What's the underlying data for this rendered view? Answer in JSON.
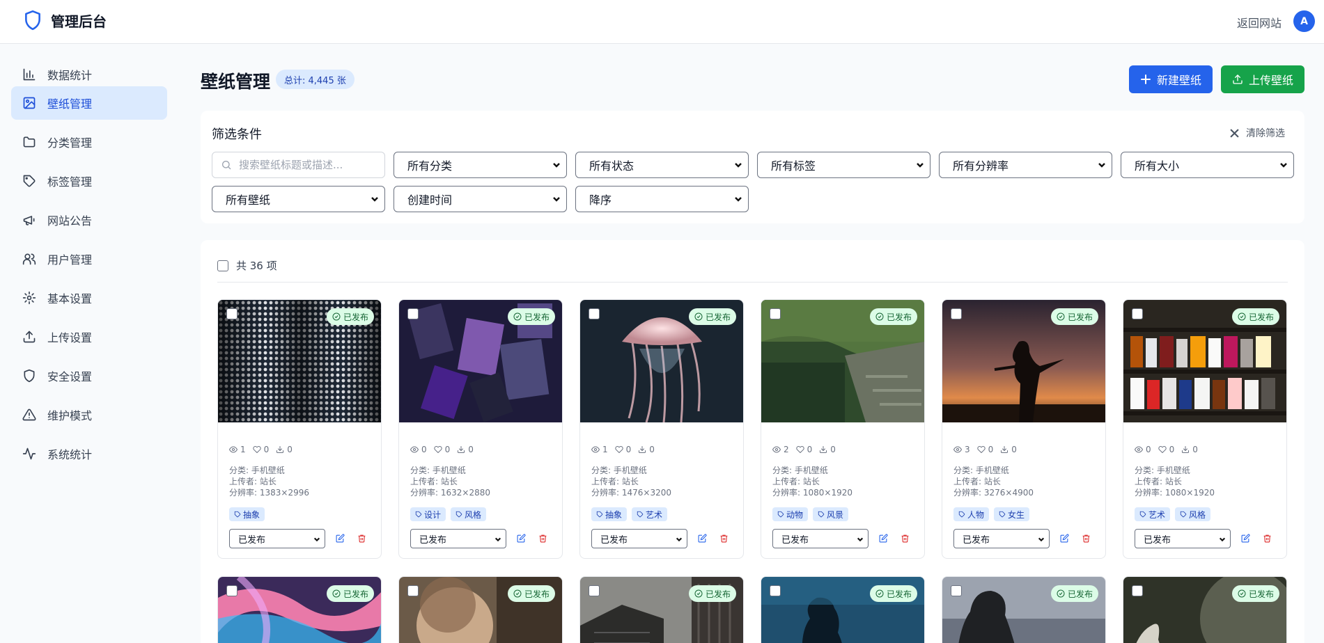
{
  "header": {
    "title": "管理后台",
    "back_link": "返回网站",
    "avatar_initial": "A"
  },
  "sidebar": {
    "items": [
      {
        "label": "数据统计",
        "icon": "bar-chart-icon"
      },
      {
        "label": "壁纸管理",
        "icon": "image-icon",
        "active": true
      },
      {
        "label": "分类管理",
        "icon": "folder-icon"
      },
      {
        "label": "标签管理",
        "icon": "tag-icon"
      },
      {
        "label": "网站公告",
        "icon": "megaphone-icon"
      },
      {
        "label": "用户管理",
        "icon": "users-icon"
      },
      {
        "label": "基本设置",
        "icon": "gear-icon"
      },
      {
        "label": "上传设置",
        "icon": "upload-icon"
      },
      {
        "label": "安全设置",
        "icon": "shield-icon"
      },
      {
        "label": "维护模式",
        "icon": "warning-icon"
      },
      {
        "label": "系统统计",
        "icon": "activity-icon"
      }
    ]
  },
  "page": {
    "title": "壁纸管理",
    "total_badge": "总计: 4,445 张",
    "new_button": "新建壁纸",
    "upload_button": "上传壁纸"
  },
  "filters": {
    "title": "筛选条件",
    "clear": "清除筛选",
    "search_placeholder": "搜索壁纸标题或描述...",
    "category": "所有分类",
    "status": "所有状态",
    "tags": "所有标签",
    "resolution": "所有分辨率",
    "size": "所有大小",
    "wallpaper": "所有壁纸",
    "sort_by": "创建时间",
    "order": "降序"
  },
  "grid": {
    "count_label": "共 36 项",
    "published_label": "已发布",
    "cards": [
      {
        "views": "1",
        "likes": "0",
        "downloads": "0",
        "category": "分类: 手机壁纸",
        "uploader": "上传者: 站长",
        "resolution": "分辨率: 1383×2996",
        "tags": [
          "抽象"
        ],
        "status": "已发布"
      },
      {
        "views": "0",
        "likes": "0",
        "downloads": "0",
        "category": "分类: 手机壁纸",
        "uploader": "上传者: 站长",
        "resolution": "分辨率: 1632×2880",
        "tags": [
          "设计",
          "风格"
        ],
        "status": "已发布"
      },
      {
        "views": "1",
        "likes": "0",
        "downloads": "0",
        "category": "分类: 手机壁纸",
        "uploader": "上传者: 站长",
        "resolution": "分辨率: 1476×3200",
        "tags": [
          "抽象",
          "艺术"
        ],
        "status": "已发布"
      },
      {
        "views": "2",
        "likes": "0",
        "downloads": "0",
        "category": "分类: 手机壁纸",
        "uploader": "上传者: 站长",
        "resolution": "分辨率: 1080×1920",
        "tags": [
          "动物",
          "风景"
        ],
        "status": "已发布"
      },
      {
        "views": "3",
        "likes": "0",
        "downloads": "0",
        "category": "分类: 手机壁纸",
        "uploader": "上传者: 站长",
        "resolution": "分辨率: 3276×4900",
        "tags": [
          "人物",
          "女生"
        ],
        "status": "已发布"
      },
      {
        "views": "0",
        "likes": "0",
        "downloads": "0",
        "category": "分类: 手机壁纸",
        "uploader": "上传者: 站长",
        "resolution": "分辨率: 1080×1920",
        "tags": [
          "艺术",
          "风格"
        ],
        "status": "已发布"
      }
    ]
  },
  "colors": {
    "primary": "#2563eb",
    "success": "#16a34a",
    "active_bg": "#dbeafe",
    "danger": "#dc2626"
  }
}
